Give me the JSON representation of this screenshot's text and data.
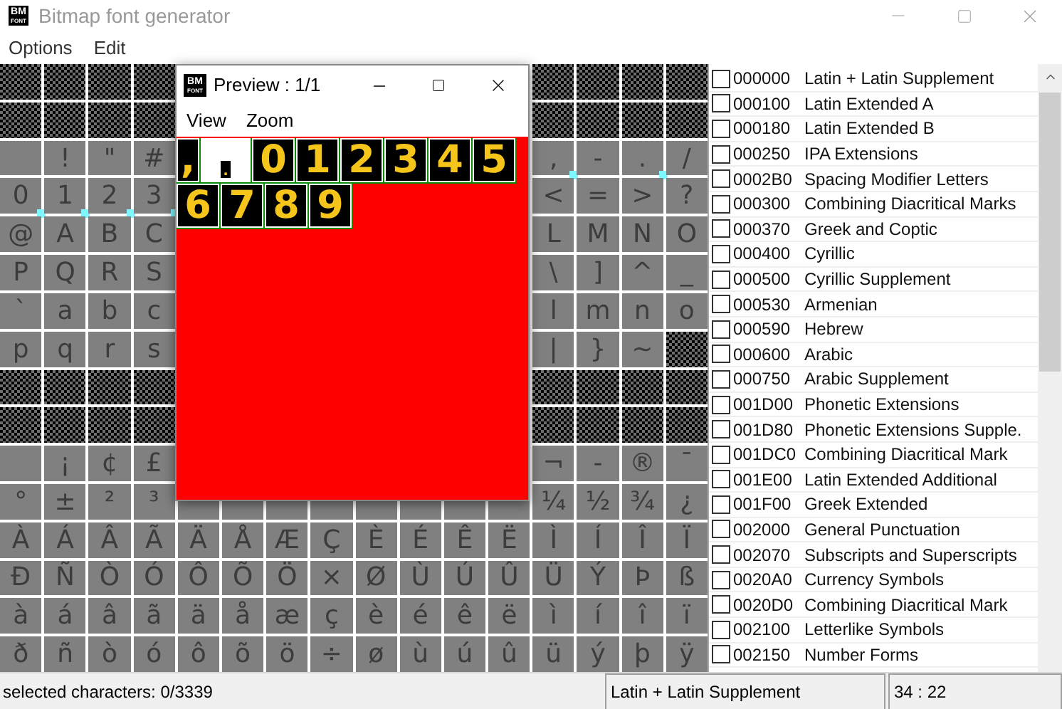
{
  "window": {
    "title": "Bitmap font generator",
    "icon": {
      "top": "BM",
      "bottom": "FONT"
    }
  },
  "menu": [
    "Options",
    "Edit"
  ],
  "grid": {
    "rows": [
      {
        "cells": [
          {
            "kind": "unused"
          },
          {
            "kind": "unused"
          },
          {
            "kind": "unused"
          },
          {
            "kind": "unused"
          },
          {
            "kind": "covered"
          },
          {
            "kind": "covered"
          },
          {
            "kind": "covered"
          },
          {
            "kind": "covered"
          },
          {
            "kind": "covered"
          },
          {
            "kind": "covered"
          },
          {
            "kind": "covered"
          },
          {
            "kind": "covered"
          },
          {
            "kind": "unused"
          },
          {
            "kind": "unused"
          },
          {
            "kind": "unused"
          },
          {
            "kind": "unused"
          }
        ]
      },
      {
        "cells": [
          {
            "kind": "unused"
          },
          {
            "kind": "unused"
          },
          {
            "kind": "unused"
          },
          {
            "kind": "unused"
          },
          {
            "kind": "covered"
          },
          {
            "kind": "covered"
          },
          {
            "kind": "covered"
          },
          {
            "kind": "covered"
          },
          {
            "kind": "covered"
          },
          {
            "kind": "covered"
          },
          {
            "kind": "covered"
          },
          {
            "kind": "covered"
          },
          {
            "kind": "unused"
          },
          {
            "kind": "unused"
          },
          {
            "kind": "unused"
          },
          {
            "kind": "unused"
          }
        ]
      },
      {
        "cells": [
          {
            "kind": "glyph",
            "marked": false
          },
          {
            "kind": "glyph",
            "text": "!",
            "marked": false
          },
          {
            "kind": "glyph",
            "text": "\"",
            "marked": false
          },
          {
            "kind": "glyph",
            "text": "#",
            "marked": false
          },
          {
            "kind": "covered"
          },
          {
            "kind": "covered"
          },
          {
            "kind": "covered"
          },
          {
            "kind": "covered"
          },
          {
            "kind": "covered"
          },
          {
            "kind": "covered"
          },
          {
            "kind": "covered"
          },
          {
            "kind": "covered"
          },
          {
            "kind": "glyph",
            "text": ",",
            "marked": true
          },
          {
            "kind": "glyph",
            "text": "-",
            "marked": false
          },
          {
            "kind": "glyph",
            "text": ".",
            "marked": true
          },
          {
            "kind": "glyph",
            "text": "/",
            "marked": false
          }
        ]
      },
      {
        "cells": [
          {
            "kind": "glyph",
            "text": "0",
            "marked": true
          },
          {
            "kind": "glyph",
            "text": "1",
            "marked": true
          },
          {
            "kind": "glyph",
            "text": "2",
            "marked": true
          },
          {
            "kind": "glyph",
            "text": "3",
            "marked": true
          },
          {
            "kind": "covered"
          },
          {
            "kind": "covered"
          },
          {
            "kind": "covered"
          },
          {
            "kind": "covered"
          },
          {
            "kind": "covered"
          },
          {
            "kind": "covered"
          },
          {
            "kind": "covered"
          },
          {
            "kind": "covered"
          },
          {
            "kind": "glyph",
            "text": "<",
            "marked": false
          },
          {
            "kind": "glyph",
            "text": "=",
            "marked": false
          },
          {
            "kind": "glyph",
            "text": ">",
            "marked": false
          },
          {
            "kind": "glyph",
            "text": "?",
            "marked": false
          }
        ]
      },
      {
        "cells": [
          {
            "kind": "glyph",
            "text": "@",
            "marked": false
          },
          {
            "kind": "glyph",
            "text": "A",
            "marked": false
          },
          {
            "kind": "glyph",
            "text": "B",
            "marked": false
          },
          {
            "kind": "glyph",
            "text": "C",
            "marked": false
          },
          {
            "kind": "covered"
          },
          {
            "kind": "covered"
          },
          {
            "kind": "covered"
          },
          {
            "kind": "covered"
          },
          {
            "kind": "covered"
          },
          {
            "kind": "covered"
          },
          {
            "kind": "covered"
          },
          {
            "kind": "covered"
          },
          {
            "kind": "glyph",
            "text": "L",
            "marked": false
          },
          {
            "kind": "glyph",
            "text": "M",
            "marked": false
          },
          {
            "kind": "glyph",
            "text": "N",
            "marked": false
          },
          {
            "kind": "glyph",
            "text": "O",
            "marked": false
          }
        ]
      },
      {
        "cells": [
          {
            "kind": "glyph",
            "text": "P",
            "marked": false
          },
          {
            "kind": "glyph",
            "text": "Q",
            "marked": false
          },
          {
            "kind": "glyph",
            "text": "R",
            "marked": false
          },
          {
            "kind": "glyph",
            "text": "S",
            "marked": false
          },
          {
            "kind": "covered"
          },
          {
            "kind": "covered"
          },
          {
            "kind": "covered"
          },
          {
            "kind": "covered"
          },
          {
            "kind": "covered"
          },
          {
            "kind": "covered"
          },
          {
            "kind": "covered"
          },
          {
            "kind": "covered"
          },
          {
            "kind": "glyph",
            "text": "\\",
            "marked": false
          },
          {
            "kind": "glyph",
            "text": "]",
            "marked": false
          },
          {
            "kind": "glyph",
            "text": "^",
            "marked": false
          },
          {
            "kind": "glyph",
            "text": "_",
            "marked": false
          }
        ]
      },
      {
        "cells": [
          {
            "kind": "glyph",
            "text": "`",
            "marked": false
          },
          {
            "kind": "glyph",
            "text": "a",
            "marked": false
          },
          {
            "kind": "glyph",
            "text": "b",
            "marked": false
          },
          {
            "kind": "glyph",
            "text": "c",
            "marked": false
          },
          {
            "kind": "covered"
          },
          {
            "kind": "covered"
          },
          {
            "kind": "covered"
          },
          {
            "kind": "covered"
          },
          {
            "kind": "covered"
          },
          {
            "kind": "covered"
          },
          {
            "kind": "covered"
          },
          {
            "kind": "covered"
          },
          {
            "kind": "glyph",
            "text": "l",
            "marked": false
          },
          {
            "kind": "glyph",
            "text": "m",
            "marked": false
          },
          {
            "kind": "glyph",
            "text": "n",
            "marked": false
          },
          {
            "kind": "glyph",
            "text": "o",
            "marked": false
          }
        ]
      },
      {
        "cells": [
          {
            "kind": "glyph",
            "text": "p",
            "marked": false
          },
          {
            "kind": "glyph",
            "text": "q",
            "marked": false
          },
          {
            "kind": "glyph",
            "text": "r",
            "marked": false
          },
          {
            "kind": "glyph",
            "text": "s",
            "marked": false
          },
          {
            "kind": "covered"
          },
          {
            "kind": "covered"
          },
          {
            "kind": "covered"
          },
          {
            "kind": "covered"
          },
          {
            "kind": "covered"
          },
          {
            "kind": "covered"
          },
          {
            "kind": "covered"
          },
          {
            "kind": "covered"
          },
          {
            "kind": "glyph",
            "text": "|",
            "marked": false
          },
          {
            "kind": "glyph",
            "text": "}",
            "marked": false
          },
          {
            "kind": "glyph",
            "text": "~",
            "marked": false
          },
          {
            "kind": "unused"
          }
        ]
      },
      {
        "cells": [
          {
            "kind": "unused"
          },
          {
            "kind": "unused"
          },
          {
            "kind": "unused"
          },
          {
            "kind": "unused"
          },
          {
            "kind": "covered"
          },
          {
            "kind": "covered"
          },
          {
            "kind": "covered"
          },
          {
            "kind": "covered"
          },
          {
            "kind": "covered"
          },
          {
            "kind": "covered"
          },
          {
            "kind": "covered"
          },
          {
            "kind": "covered"
          },
          {
            "kind": "unused"
          },
          {
            "kind": "unused"
          },
          {
            "kind": "unused"
          },
          {
            "kind": "unused"
          }
        ]
      },
      {
        "cells": [
          {
            "kind": "unused"
          },
          {
            "kind": "unused"
          },
          {
            "kind": "unused"
          },
          {
            "kind": "unused"
          },
          {
            "kind": "covered"
          },
          {
            "kind": "covered"
          },
          {
            "kind": "covered"
          },
          {
            "kind": "covered"
          },
          {
            "kind": "covered"
          },
          {
            "kind": "covered"
          },
          {
            "kind": "covered"
          },
          {
            "kind": "covered"
          },
          {
            "kind": "unused"
          },
          {
            "kind": "unused"
          },
          {
            "kind": "unused"
          },
          {
            "kind": "unused"
          }
        ]
      },
      {
        "cells": [
          {
            "kind": "glyph",
            "marked": false
          },
          {
            "kind": "glyph",
            "text": "¡",
            "marked": false
          },
          {
            "kind": "glyph",
            "text": "¢",
            "marked": false
          },
          {
            "kind": "glyph",
            "text": "£",
            "marked": false
          },
          {
            "kind": "covered"
          },
          {
            "kind": "covered"
          },
          {
            "kind": "covered"
          },
          {
            "kind": "covered"
          },
          {
            "kind": "covered"
          },
          {
            "kind": "covered"
          },
          {
            "kind": "covered"
          },
          {
            "kind": "covered"
          },
          {
            "kind": "glyph",
            "text": "¬",
            "marked": false
          },
          {
            "kind": "glyph",
            "text": "-",
            "marked": false
          },
          {
            "kind": "glyph",
            "text": "®",
            "marked": false
          },
          {
            "kind": "glyph",
            "text": "¯",
            "marked": false
          }
        ]
      },
      {
        "cells": [
          {
            "kind": "glyph",
            "text": "°",
            "marked": false
          },
          {
            "kind": "glyph",
            "text": "±",
            "marked": false
          },
          {
            "kind": "glyph",
            "text": "²",
            "marked": false
          },
          {
            "kind": "glyph",
            "text": "³",
            "marked": false
          },
          {
            "kind": "blank"
          },
          {
            "kind": "blank"
          },
          {
            "kind": "blank"
          },
          {
            "kind": "blank"
          },
          {
            "kind": "blank"
          },
          {
            "kind": "blank"
          },
          {
            "kind": "blank"
          },
          {
            "kind": "blank"
          },
          {
            "kind": "glyph",
            "text": "¼",
            "marked": false
          },
          {
            "kind": "glyph",
            "text": "½",
            "marked": false
          },
          {
            "kind": "glyph",
            "text": "¾",
            "marked": false
          },
          {
            "kind": "glyph",
            "text": "¿",
            "marked": false
          }
        ]
      },
      {
        "cells": [
          {
            "kind": "glyph",
            "text": "À",
            "marked": false
          },
          {
            "kind": "glyph",
            "text": "Á",
            "marked": false
          },
          {
            "kind": "glyph",
            "text": "Â",
            "marked": false
          },
          {
            "kind": "glyph",
            "text": "Ã",
            "marked": false
          },
          {
            "kind": "glyph",
            "text": "Ä",
            "marked": false
          },
          {
            "kind": "glyph",
            "text": "Å",
            "marked": false
          },
          {
            "kind": "glyph",
            "text": "Æ",
            "marked": false
          },
          {
            "kind": "glyph",
            "text": "Ç",
            "marked": false
          },
          {
            "kind": "glyph",
            "text": "È",
            "marked": false
          },
          {
            "kind": "glyph",
            "text": "É",
            "marked": false
          },
          {
            "kind": "glyph",
            "text": "Ê",
            "marked": false
          },
          {
            "kind": "glyph",
            "text": "Ë",
            "marked": false
          },
          {
            "kind": "glyph",
            "text": "Ì",
            "marked": false
          },
          {
            "kind": "glyph",
            "text": "Í",
            "marked": false
          },
          {
            "kind": "glyph",
            "text": "Î",
            "marked": false
          },
          {
            "kind": "glyph",
            "text": "Ï",
            "marked": false
          }
        ]
      },
      {
        "cells": [
          {
            "kind": "glyph",
            "text": "Ð",
            "marked": false
          },
          {
            "kind": "glyph",
            "text": "Ñ",
            "marked": false
          },
          {
            "kind": "glyph",
            "text": "Ò",
            "marked": false
          },
          {
            "kind": "glyph",
            "text": "Ó",
            "marked": false
          },
          {
            "kind": "glyph",
            "text": "Ô",
            "marked": false
          },
          {
            "kind": "glyph",
            "text": "Õ",
            "marked": false
          },
          {
            "kind": "glyph",
            "text": "Ö",
            "marked": false
          },
          {
            "kind": "glyph",
            "text": "×",
            "marked": false
          },
          {
            "kind": "glyph",
            "text": "Ø",
            "marked": false
          },
          {
            "kind": "glyph",
            "text": "Ù",
            "marked": false
          },
          {
            "kind": "glyph",
            "text": "Ú",
            "marked": false
          },
          {
            "kind": "glyph",
            "text": "Û",
            "marked": false
          },
          {
            "kind": "glyph",
            "text": "Ü",
            "marked": false
          },
          {
            "kind": "glyph",
            "text": "Ý",
            "marked": false
          },
          {
            "kind": "glyph",
            "text": "Þ",
            "marked": false
          },
          {
            "kind": "glyph",
            "text": "ß",
            "marked": false
          }
        ]
      },
      {
        "cells": [
          {
            "kind": "glyph",
            "text": "à",
            "marked": false
          },
          {
            "kind": "glyph",
            "text": "á",
            "marked": false
          },
          {
            "kind": "glyph",
            "text": "â",
            "marked": false
          },
          {
            "kind": "glyph",
            "text": "ã",
            "marked": false
          },
          {
            "kind": "glyph",
            "text": "ä",
            "marked": false
          },
          {
            "kind": "glyph",
            "text": "å",
            "marked": false
          },
          {
            "kind": "glyph",
            "text": "æ",
            "marked": false
          },
          {
            "kind": "glyph",
            "text": "ç",
            "marked": false
          },
          {
            "kind": "glyph",
            "text": "è",
            "marked": false
          },
          {
            "kind": "glyph",
            "text": "é",
            "marked": false
          },
          {
            "kind": "glyph",
            "text": "ê",
            "marked": false
          },
          {
            "kind": "glyph",
            "text": "ë",
            "marked": false
          },
          {
            "kind": "glyph",
            "text": "ì",
            "marked": false
          },
          {
            "kind": "glyph",
            "text": "í",
            "marked": false
          },
          {
            "kind": "glyph",
            "text": "î",
            "marked": false
          },
          {
            "kind": "glyph",
            "text": "ï",
            "marked": false
          }
        ]
      },
      {
        "cells": [
          {
            "kind": "glyph",
            "text": "ð",
            "marked": false
          },
          {
            "kind": "glyph",
            "text": "ñ",
            "marked": false
          },
          {
            "kind": "glyph",
            "text": "ò",
            "marked": false
          },
          {
            "kind": "glyph",
            "text": "ó",
            "marked": false
          },
          {
            "kind": "glyph",
            "text": "ô",
            "marked": false
          },
          {
            "kind": "glyph",
            "text": "õ",
            "marked": false
          },
          {
            "kind": "glyph",
            "text": "ö",
            "marked": false
          },
          {
            "kind": "glyph",
            "text": "÷",
            "marked": false
          },
          {
            "kind": "glyph",
            "text": "ø",
            "marked": false
          },
          {
            "kind": "glyph",
            "text": "ù",
            "marked": false
          },
          {
            "kind": "glyph",
            "text": "ú",
            "marked": false
          },
          {
            "kind": "glyph",
            "text": "û",
            "marked": false
          },
          {
            "kind": "glyph",
            "text": "ü",
            "marked": false
          },
          {
            "kind": "glyph",
            "text": "ý",
            "marked": false
          },
          {
            "kind": "glyph",
            "text": "þ",
            "marked": false
          },
          {
            "kind": "glyph",
            "text": "ÿ",
            "marked": false
          }
        ]
      }
    ]
  },
  "ranges": [
    {
      "code": "000000",
      "name": "Latin + Latin Supplement",
      "checked": false
    },
    {
      "code": "000100",
      "name": "Latin Extended A",
      "checked": false
    },
    {
      "code": "000180",
      "name": "Latin Extended B",
      "checked": false
    },
    {
      "code": "000250",
      "name": "IPA Extensions",
      "checked": false
    },
    {
      "code": "0002B0",
      "name": "Spacing Modifier Letters",
      "checked": false
    },
    {
      "code": "000300",
      "name": "Combining Diacritical Marks",
      "checked": false
    },
    {
      "code": "000370",
      "name": "Greek and Coptic",
      "checked": false
    },
    {
      "code": "000400",
      "name": "Cyrillic",
      "checked": false
    },
    {
      "code": "000500",
      "name": "Cyrillic Supplement",
      "checked": false
    },
    {
      "code": "000530",
      "name": "Armenian",
      "checked": false
    },
    {
      "code": "000590",
      "name": "Hebrew",
      "checked": false
    },
    {
      "code": "000600",
      "name": "Arabic",
      "checked": false
    },
    {
      "code": "000750",
      "name": "Arabic Supplement",
      "checked": false
    },
    {
      "code": "001D00",
      "name": "Phonetic Extensions",
      "checked": false
    },
    {
      "code": "001D80",
      "name": "Phonetic Extensions Supple.",
      "checked": false
    },
    {
      "code": "001DC0",
      "name": "Combining Diacritical Mark",
      "checked": false
    },
    {
      "code": "001E00",
      "name": "Latin Extended Additional",
      "checked": false
    },
    {
      "code": "001F00",
      "name": "Greek Extended",
      "checked": false
    },
    {
      "code": "002000",
      "name": "General Punctuation",
      "checked": false
    },
    {
      "code": "002070",
      "name": "Subscripts and Superscripts",
      "checked": false
    },
    {
      "code": "0020A0",
      "name": "Currency Symbols",
      "checked": false
    },
    {
      "code": "0020D0",
      "name": "Combining Diacritical Mark",
      "checked": false
    },
    {
      "code": "002100",
      "name": "Letterlike Symbols",
      "checked": false
    },
    {
      "code": "002150",
      "name": "Number Forms",
      "checked": false
    }
  ],
  "preview": {
    "title": "Preview : 1/1",
    "icon": {
      "top": "BM",
      "bottom": "FONT"
    },
    "menu": [
      "View",
      "Zoom"
    ],
    "rows": [
      {
        "glyphs": [
          {
            "text": ",",
            "kind": "narrow"
          },
          {
            "text": ".",
            "kind": "small"
          },
          {
            "text": "0",
            "kind": "full"
          },
          {
            "text": "1",
            "kind": "full"
          },
          {
            "text": "2",
            "kind": "full"
          },
          {
            "text": "3",
            "kind": "full"
          },
          {
            "text": "4",
            "kind": "full"
          },
          {
            "text": "5",
            "kind": "full"
          }
        ]
      },
      {
        "glyphs": [
          {
            "text": "6",
            "kind": "full"
          },
          {
            "text": "7",
            "kind": "full"
          },
          {
            "text": "8",
            "kind": "full"
          },
          {
            "text": "9",
            "kind": "full"
          }
        ]
      }
    ]
  },
  "status_bar": {
    "selection": "selected characters: 0/3339",
    "range": "Latin + Latin Supplement",
    "position": "34 : 22"
  }
}
